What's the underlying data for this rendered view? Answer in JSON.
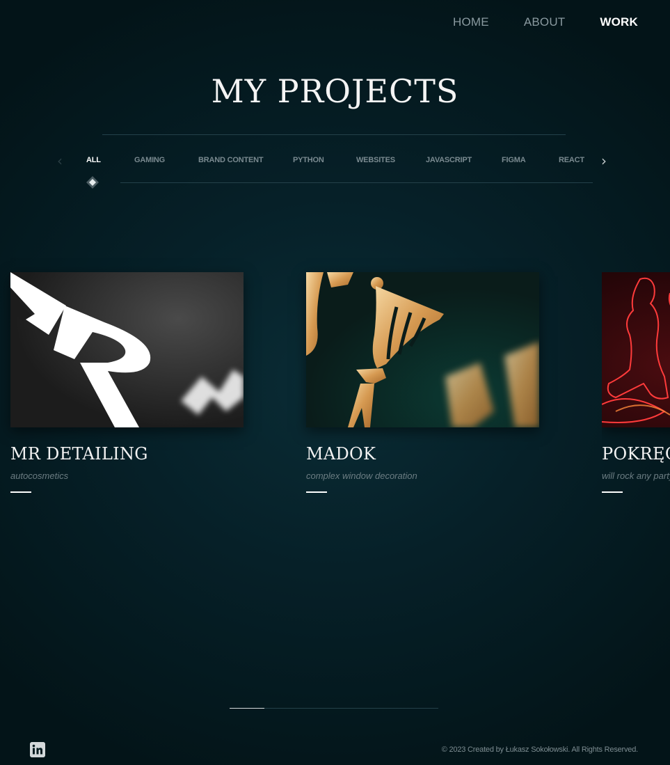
{
  "nav": {
    "items": [
      {
        "label": "HOME"
      },
      {
        "label": "ABOUT"
      },
      {
        "label": "WORK"
      }
    ],
    "active": "WORK"
  },
  "header": {
    "title": "MY PROJECTS"
  },
  "filters": {
    "active": "ALL",
    "items": [
      "ALL",
      "GAMING",
      "BRAND CONTENT",
      "PYTHON",
      "WEBSITES",
      "JAVASCRIPT",
      "FIGMA",
      "REACT"
    ]
  },
  "projects": [
    {
      "title": "MR DETAILING",
      "subtitle": "autocosmetics"
    },
    {
      "title": "MADOK",
      "subtitle": "complex window decoration"
    },
    {
      "title": "POKRĘCONE",
      "subtitle": "will rock any party"
    }
  ],
  "slider": {
    "progress": 0.1667
  },
  "footer": {
    "copyright": "© 2023 Created by Łukasz Sokołowski. All Rights Reserved.",
    "social_icon": "linkedin-icon"
  },
  "colors": {
    "background": "#062028",
    "accent": "#ffffff",
    "muted_text": "#7a8a90"
  }
}
